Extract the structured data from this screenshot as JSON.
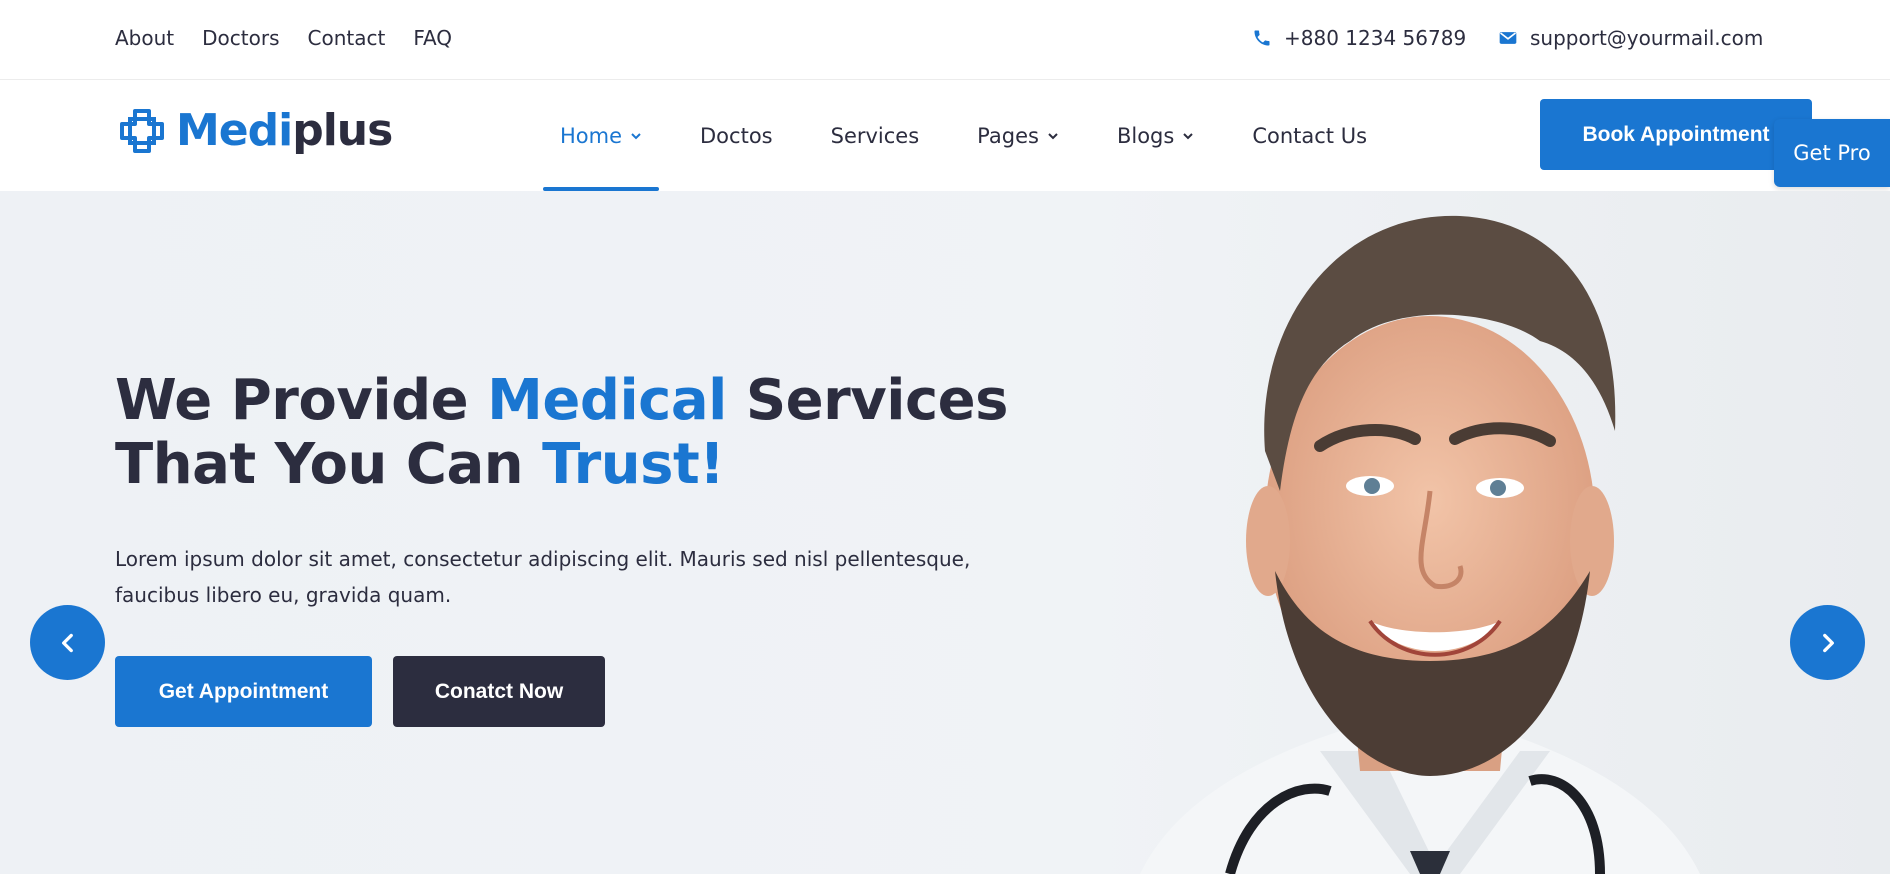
{
  "topbar": {
    "links": [
      "About",
      "Doctors",
      "Contact",
      "FAQ"
    ],
    "phone": "+880 1234 56789",
    "email": "support@yourmail.com"
  },
  "nav": {
    "logo": {
      "part1": "Medi",
      "part2": "plus"
    },
    "items": [
      {
        "label": "Home",
        "dropdown": true,
        "active": true
      },
      {
        "label": "Doctos",
        "dropdown": false
      },
      {
        "label": "Services",
        "dropdown": false
      },
      {
        "label": "Pages",
        "dropdown": true
      },
      {
        "label": "Blogs",
        "dropdown": true
      },
      {
        "label": "Contact Us",
        "dropdown": false
      }
    ],
    "book_button": "Book Appointment",
    "get_pro": "Get Pro"
  },
  "hero": {
    "title_1": "We Provide ",
    "title_hl_1": "Medical",
    "title_2": " Services",
    "title_3": "That You Can ",
    "title_hl_2": "Trust!",
    "text": "Lorem ipsum dolor sit amet, consectetur adipiscing elit. Mauris sed nisl pellentesque, faucibus libero eu, gravida quam.",
    "primary_button": "Get Appointment",
    "secondary_button": "Conatct Now"
  },
  "colors": {
    "accent": "#1a76d1",
    "dark": "#2c2d3f",
    "hero_bg": "#eef1f5"
  },
  "icons": [
    "phone-icon",
    "mail-icon",
    "logo-cross-icon",
    "chevron-down-icon",
    "arrow-left-icon",
    "arrow-right-icon"
  ]
}
